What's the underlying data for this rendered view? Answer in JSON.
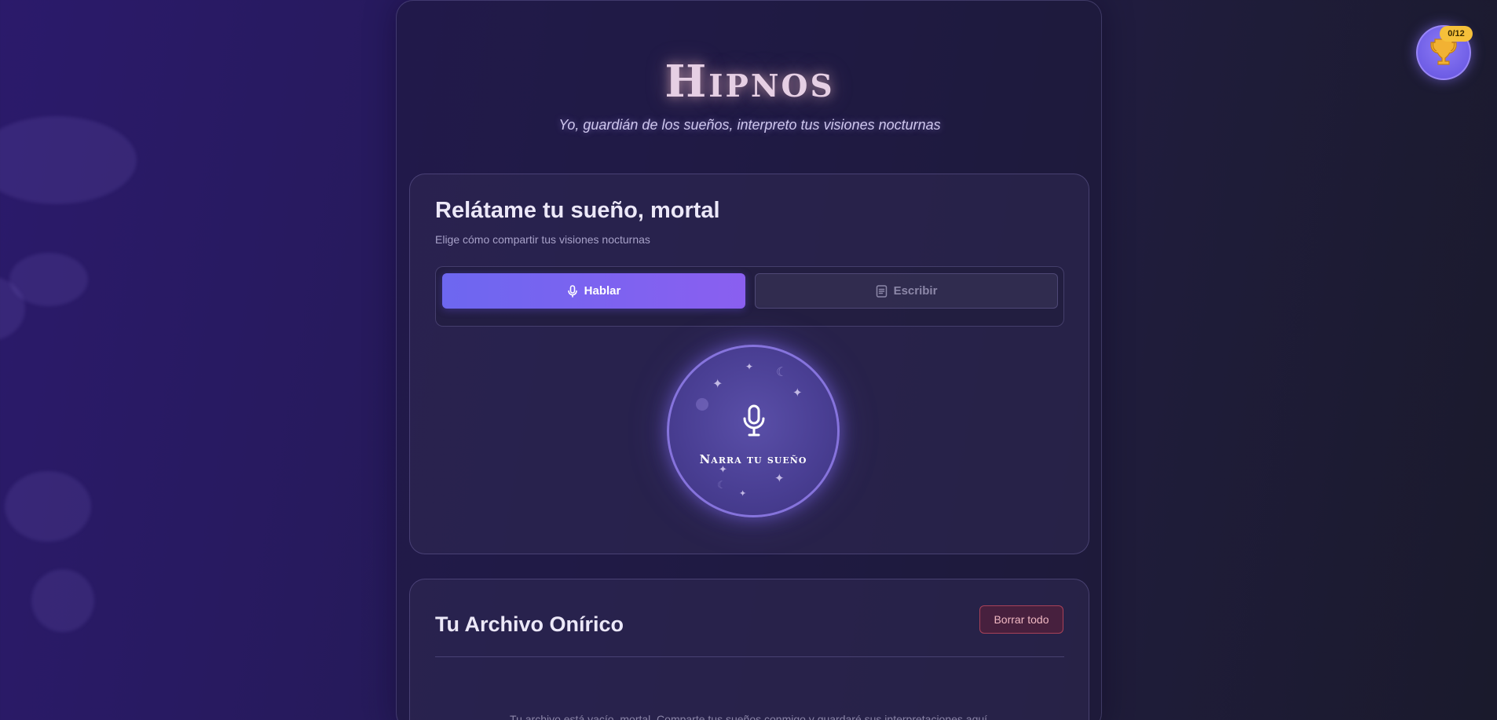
{
  "header": {
    "title": "Hipnos",
    "subtitle": "Yo, guardián de los sueños, interpreto tus visiones nocturnas"
  },
  "input_card": {
    "title": "Relátame tu sueño, mortal",
    "subtitle": "Elige cómo compartir tus visiones nocturnas",
    "modes": [
      {
        "label": "Hablar",
        "icon": "microphone-icon",
        "active": true
      },
      {
        "label": "Escribir",
        "icon": "document-icon",
        "active": false
      }
    ],
    "record_button": {
      "label": "Narra tu sueño",
      "icon": "microphone-icon"
    }
  },
  "archive": {
    "title": "Tu Archivo Onírico",
    "clear_label": "Borrar todo",
    "empty_message": "Tu archivo está vacío, mortal. Comparte tus sueños conmigo y guardaré sus interpretaciones aquí."
  },
  "achievements": {
    "count": "0/12",
    "icon": "trophy-icon"
  },
  "colors": {
    "accent": "#6d67f0",
    "accent_end": "#8a5ff0",
    "badge": "#f5c03a",
    "danger": "#d2506a"
  }
}
